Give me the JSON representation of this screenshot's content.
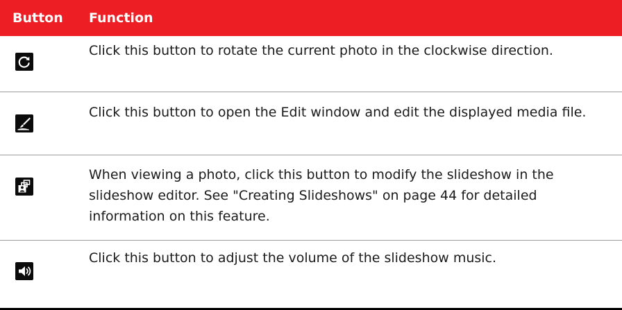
{
  "table": {
    "headers": {
      "button": "Button",
      "function": "Function"
    },
    "rows": [
      {
        "icon": "rotate-clockwise-icon",
        "description": "Click this button to rotate the current photo in the clockwise direction."
      },
      {
        "icon": "edit-brush-icon",
        "description": "Click this button to open the Edit window and edit the displayed media file."
      },
      {
        "icon": "slideshow-editor-icon",
        "description": "When viewing a photo, click this button to modify the slideshow in the slideshow editor. See \"Creating Slideshows\" on page 44 for detailed information on this feature."
      },
      {
        "icon": "volume-speaker-icon",
        "description": "Click this button to adjust the volume of the slideshow music."
      }
    ]
  },
  "colors": {
    "header_background": "#ee1f24",
    "header_text": "#ffffff",
    "icon_background": "#0b0b0b"
  }
}
